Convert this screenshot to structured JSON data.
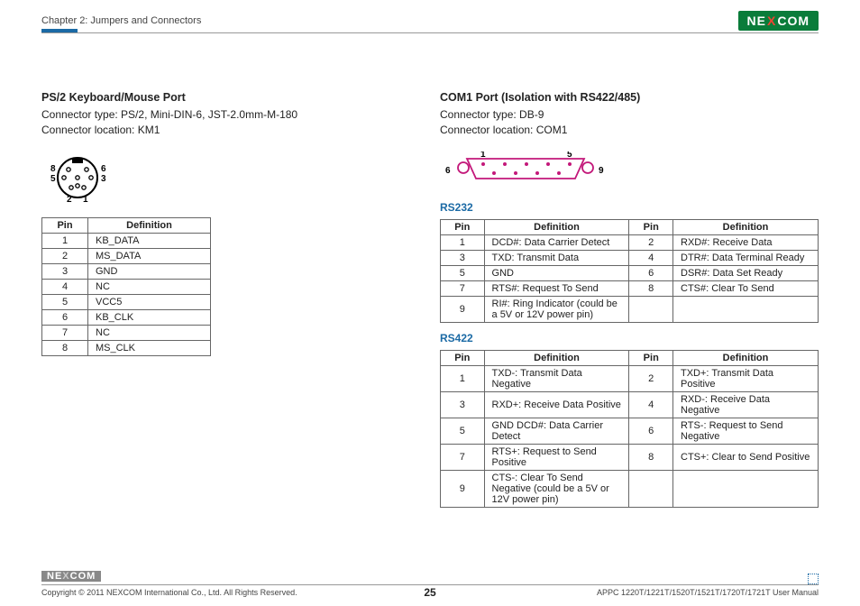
{
  "header": {
    "chapter": "Chapter 2: Jumpers and Connectors",
    "brand_left": "NE",
    "brand_mid": "X",
    "brand_right": "COM"
  },
  "left": {
    "title": "PS/2 Keyboard/Mouse Port",
    "line1": "Connector type: PS/2, Mini-DIN-6, JST-2.0mm-M-180",
    "line2": "Connector location: KM1",
    "labels": {
      "p1": "1",
      "p2": "2",
      "p3": "3",
      "p5": "5",
      "p6": "6",
      "p8": "8"
    },
    "th_pin": "Pin",
    "th_def": "Definition",
    "rows": [
      {
        "pin": "1",
        "def": "KB_DATA"
      },
      {
        "pin": "2",
        "def": "MS_DATA"
      },
      {
        "pin": "3",
        "def": "GND"
      },
      {
        "pin": "4",
        "def": "NC"
      },
      {
        "pin": "5",
        "def": "VCC5"
      },
      {
        "pin": "6",
        "def": "KB_CLK"
      },
      {
        "pin": "7",
        "def": "NC"
      },
      {
        "pin": "8",
        "def": "MS_CLK"
      }
    ]
  },
  "right": {
    "title": "COM1 Port (Isolation with RS422/485)",
    "line1": "Connector type: DB-9",
    "line2": "Connector location: COM1",
    "labels": {
      "p1": "1",
      "p5": "5",
      "p6": "6",
      "p9": "9"
    },
    "rs232_label": "RS232",
    "rs422_label": "RS422",
    "th_pin": "Pin",
    "th_def": "Definition",
    "rs232_rows": [
      {
        "p1": "1",
        "d1": "DCD#: Data Carrier Detect",
        "p2": "2",
        "d2": "RXD#: Receive Data"
      },
      {
        "p1": "3",
        "d1": "TXD: Transmit Data",
        "p2": "4",
        "d2": "DTR#: Data Terminal Ready"
      },
      {
        "p1": "5",
        "d1": "GND",
        "p2": "6",
        "d2": "DSR#: Data Set Ready"
      },
      {
        "p1": "7",
        "d1": "RTS#: Request To Send",
        "p2": "8",
        "d2": "CTS#: Clear To Send"
      },
      {
        "p1": "9",
        "d1": "RI#: Ring Indicator (could be a 5V or 12V power pin)",
        "p2": "",
        "d2": ""
      }
    ],
    "rs422_rows": [
      {
        "p1": "1",
        "d1": "TXD-: Transmit Data Negative",
        "p2": "2",
        "d2": "TXD+: Transmit Data Positive"
      },
      {
        "p1": "3",
        "d1": "RXD+: Receive Data Positive",
        "p2": "4",
        "d2": "RXD-: Receive Data Negative"
      },
      {
        "p1": "5",
        "d1": "GND DCD#: Data Carrier Detect",
        "p2": "6",
        "d2": "RTS-: Request to Send Negative"
      },
      {
        "p1": "7",
        "d1": "RTS+: Request to Send Positive",
        "p2": "8",
        "d2": "CTS+: Clear to Send Positive"
      },
      {
        "p1": "9",
        "d1": "CTS-: Clear To Send Negative (could be a 5V or 12V power pin)",
        "p2": "",
        "d2": ""
      }
    ]
  },
  "footer": {
    "logo_left": "NE",
    "logo_mid": "X",
    "logo_right": "COM",
    "copyright": "Copyright © 2011 NEXCOM International Co., Ltd. All Rights Reserved.",
    "page": "25",
    "manual": "APPC 1220T/1221T/1520T/1521T/1720T/1721T User Manual"
  }
}
